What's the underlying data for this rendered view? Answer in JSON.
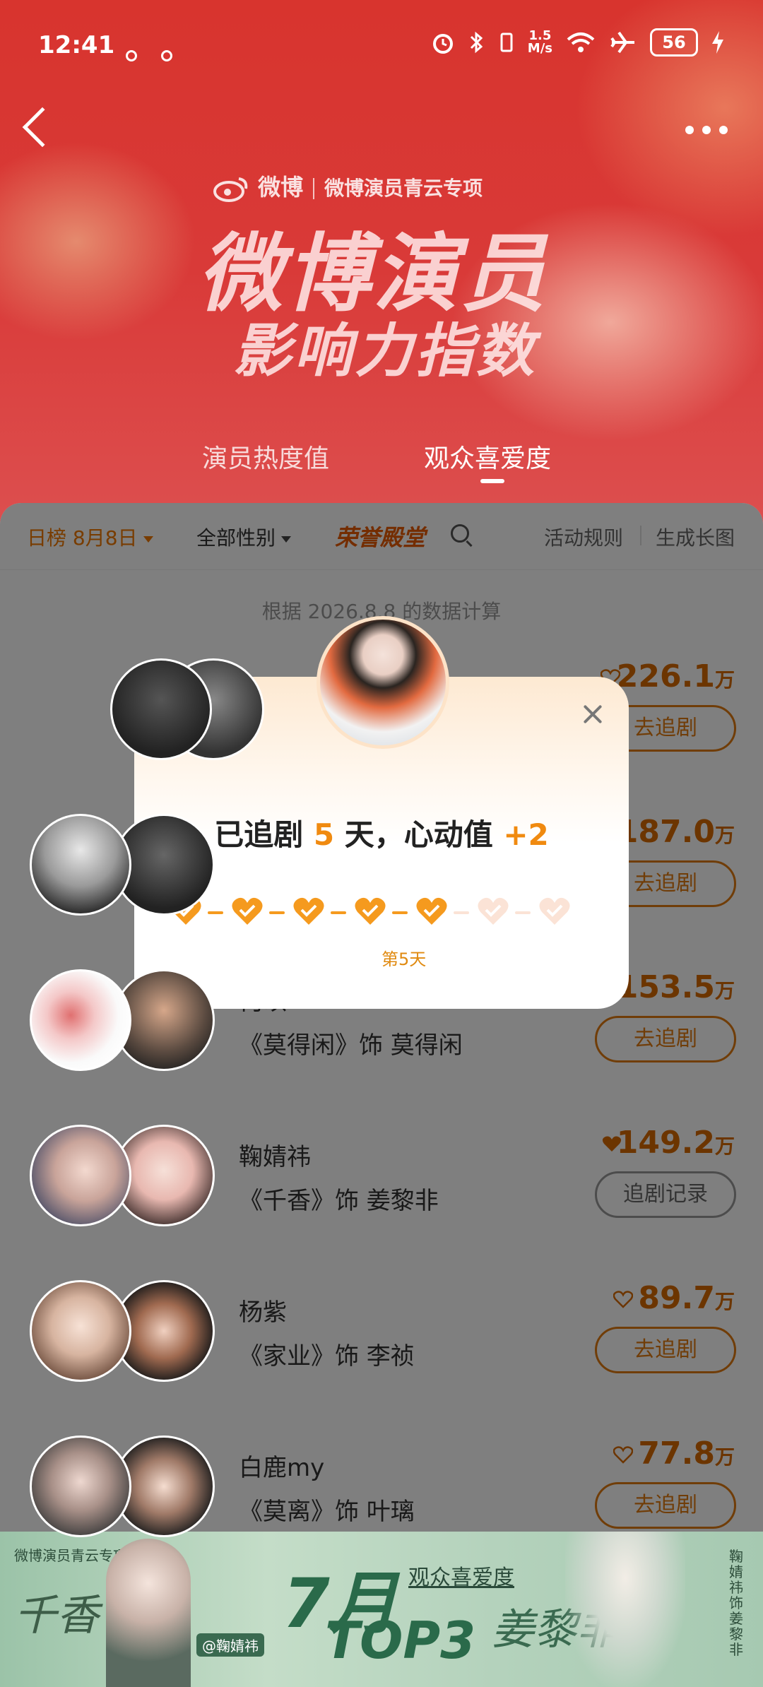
{
  "status": {
    "time": "12:41",
    "net_speed_value": "1.5",
    "net_speed_unit": "M/s",
    "battery": "56"
  },
  "header": {
    "brand": "微博",
    "brand_sub": "微博演员青云专项",
    "title_line1": "微博演员",
    "title_line2": "影响力指数",
    "tabs": [
      {
        "label": "演员热度值",
        "active": false
      },
      {
        "label": "观众喜爱度",
        "active": true
      }
    ]
  },
  "filters": {
    "period": "日榜 8月8日",
    "gender": "全部性别",
    "hall": "荣誉殿堂",
    "rules": "活动规则",
    "share": "生成长图"
  },
  "calc_note": "根据 2026.8.8 的数据计算",
  "list": [
    {
      "name": "",
      "role": "",
      "score": "226.1",
      "unit": "万",
      "liked": false,
      "button": "去追剧"
    },
    {
      "name": "",
      "role": "",
      "score": "187.0",
      "unit": "万",
      "liked": false,
      "button": "去追剧"
    },
    {
      "name": "何以",
      "role": "《莫得闲》饰 莫得闲",
      "score": "153.5",
      "unit": "万",
      "liked": false,
      "button": "去追剧"
    },
    {
      "name": "鞠婧祎",
      "role": "《千香》饰 姜黎非",
      "score": "149.2",
      "unit": "万",
      "liked": true,
      "button": "追剧记录"
    },
    {
      "name": "杨紫",
      "role": "《家业》饰 李祯",
      "score": "89.7",
      "unit": "万",
      "liked": false,
      "button": "去追剧"
    },
    {
      "name": "白鹿my",
      "role": "《莫离》饰 叶璃",
      "score": "77.8",
      "unit": "万",
      "liked": false,
      "button": "去追剧"
    }
  ],
  "modal": {
    "prefix": "已追剧",
    "days": "5",
    "mid": "天，心动值",
    "gain": "+2",
    "streak_total": 7,
    "streak_done": 5,
    "day_label": "第5天"
  },
  "banner": {
    "label": "微博演员青云专项",
    "drama": "千香",
    "month": "7月",
    "rank": "TOP3",
    "category": "观众喜爱度",
    "handle": "@鞠婧祎",
    "character": "姜黎非",
    "vertical_text": "鞠婧祎饰姜黎非"
  },
  "colors": {
    "accent": "#f08a10",
    "hero_red": "#d8342e",
    "heart_done": "#f59a1e",
    "heart_todo": "#fbe3d6"
  }
}
